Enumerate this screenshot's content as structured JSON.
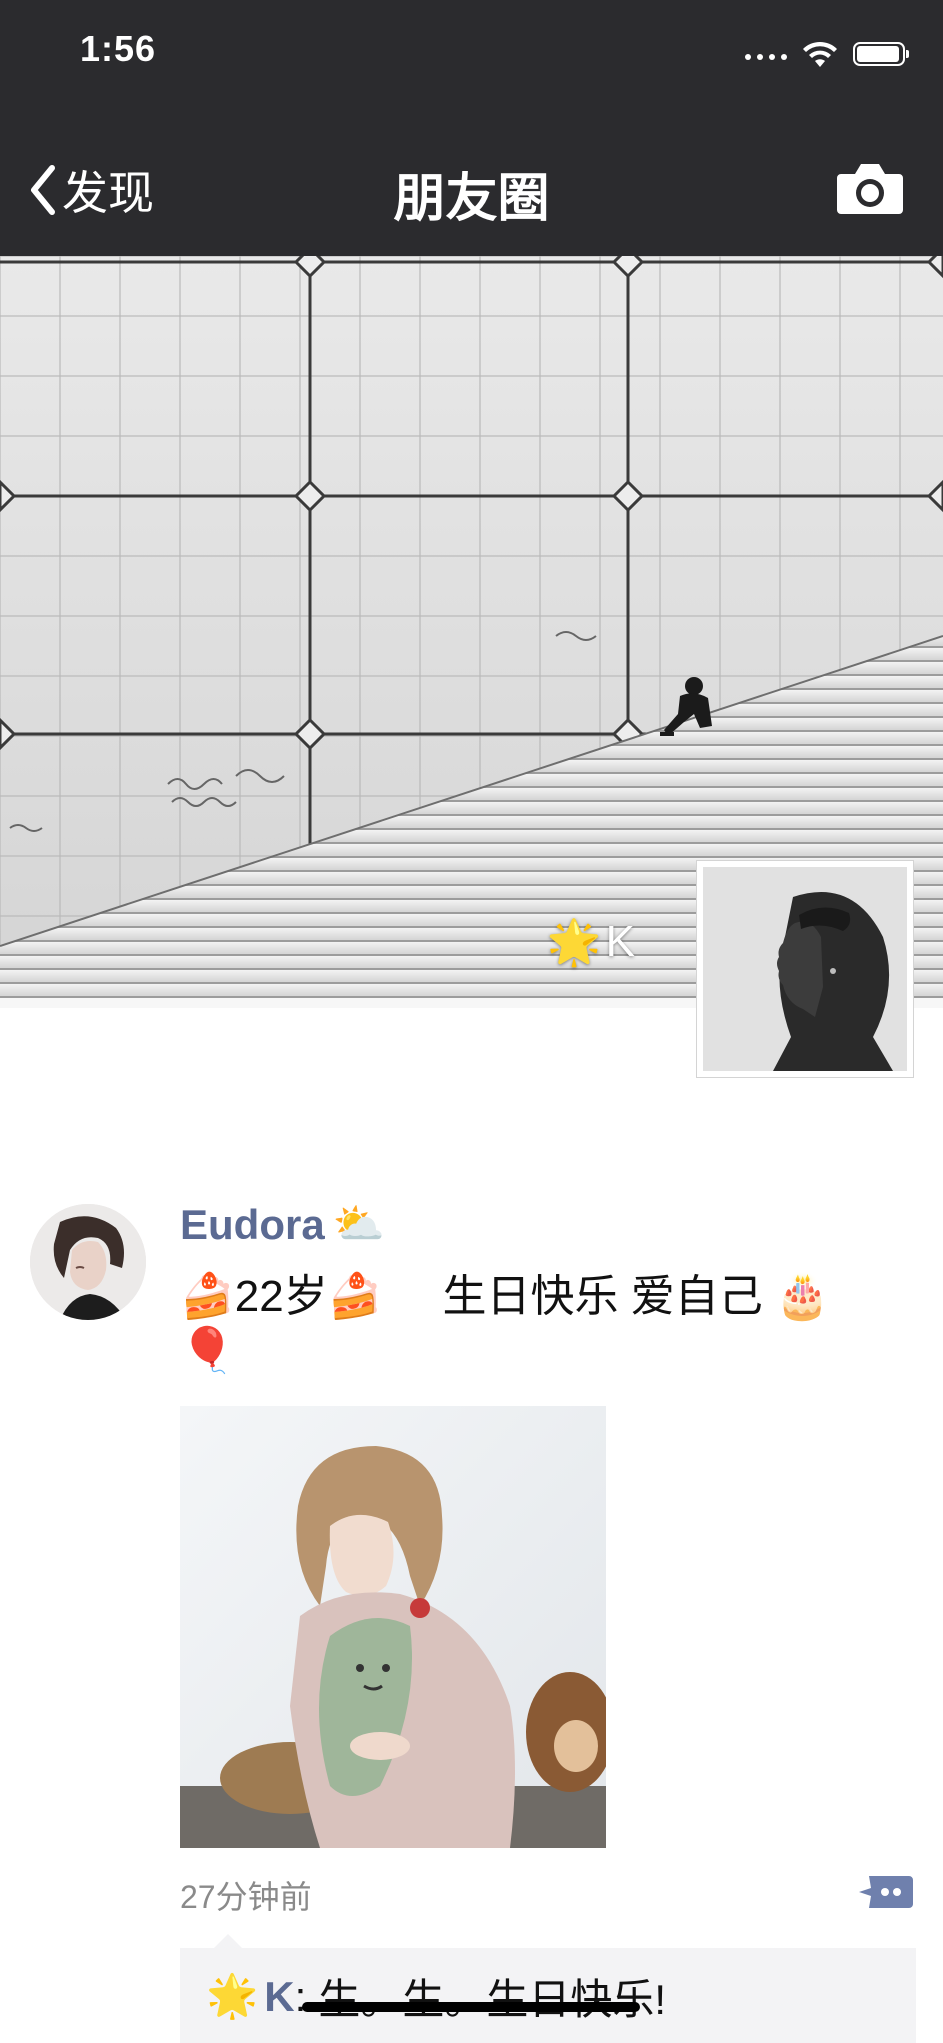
{
  "status_bar": {
    "time": "1:56"
  },
  "nav": {
    "back_label": "发现",
    "title": "朋友圈"
  },
  "cover": {
    "owner_name_emoji": "🌟",
    "owner_name": "K"
  },
  "post": {
    "author": "Eudora",
    "author_emoji": "⛅",
    "text_part1": "🍰22岁🍰",
    "text_part2": "生日快乐  爱自己 🎂",
    "text_part3": "🎈",
    "time": "27分钟前",
    "comment": {
      "author_emoji": "🌟",
      "author": "K",
      "separator": ":",
      "text": "生。生。生日快乐!"
    }
  },
  "colors": {
    "topbar": "#2b2b2e",
    "link_blue": "#5b6a92",
    "comment_bg": "#f3f3f5"
  }
}
